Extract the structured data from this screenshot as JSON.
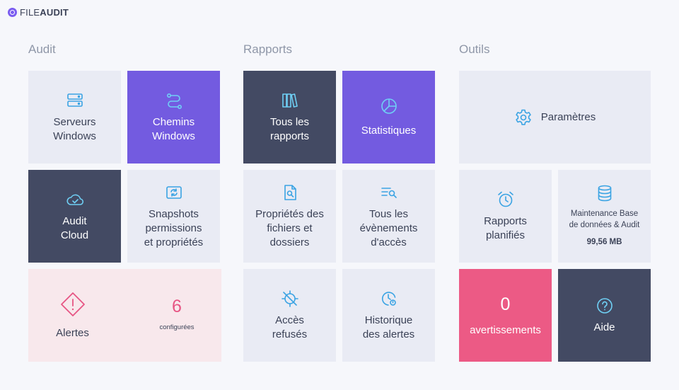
{
  "app": {
    "logo_prefix": "FILE",
    "logo_suffix": "AUDIT"
  },
  "sections": {
    "audit": "Audit",
    "reports": "Rapports",
    "tools": "Outils"
  },
  "audit": {
    "servers": "Serveurs\nWindows",
    "paths": "Chemins\nWindows",
    "cloud": "Audit\nCloud",
    "snapshots": "Snapshots\npermissions\net propriétés",
    "alerts": {
      "label": "Alertes",
      "count": "6",
      "count_label": "configurées"
    }
  },
  "reports": {
    "all_reports": "Tous les\nrapports",
    "statistics": "Statistiques",
    "file_props": "Propriétés des\nfichiers et\ndossiers",
    "access_events": "Tous les\névènements\nd'accès",
    "denied": "Accès\nrefusés",
    "alert_history": "Historique\ndes alertes"
  },
  "tools": {
    "settings": "Paramètres",
    "scheduled": "Rapports\nplanifiés",
    "maintenance": "Maintenance Base\nde données & Audit",
    "db_size": "99,56 MB",
    "warnings_count": "0",
    "warnings_label": "avertissements",
    "help": "Aide"
  },
  "colors": {
    "accent_purple": "#735be0",
    "dark_tile": "#434a63",
    "light_tile": "#e9ebf4",
    "icon_blue": "#3aa3e3",
    "alert_pink": "#e75584",
    "warning_red": "#ec5a85"
  },
  "icons": {
    "servers": "server-icon",
    "paths": "route-icon",
    "cloud": "cloud-check-icon",
    "snapshots": "refresh-image-icon",
    "alerts": "warning-diamond-icon",
    "all_reports": "books-icon",
    "statistics": "pie-chart-icon",
    "file_props": "file-search-icon",
    "access_events": "list-search-icon",
    "denied": "access-denied-icon",
    "alert_history": "clock-history-icon",
    "settings": "gear-icon",
    "scheduled": "alarm-clock-icon",
    "maintenance": "database-icon",
    "help": "help-circle-icon"
  }
}
